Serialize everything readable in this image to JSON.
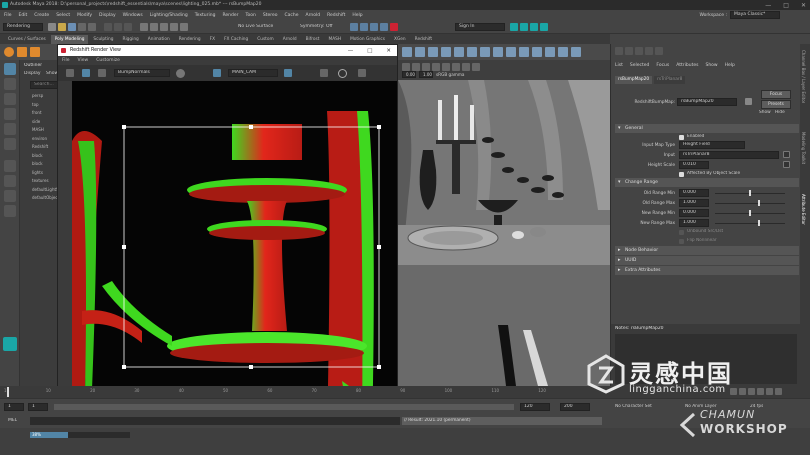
{
  "titlebar": {
    "text": "Autodesk Maya 2018: D:\\personal_projects\\redshift_essentials\\maya\\scenes\\lighting_025.mb* --- rsBumpMap20",
    "controls": [
      "—",
      "□",
      "✕"
    ]
  },
  "menubar": {
    "items": [
      "File",
      "Edit",
      "Create",
      "Select",
      "Modify",
      "Display",
      "Windows",
      "Lighting/Shading",
      "Texturing",
      "Render",
      "Toon",
      "Stereo",
      "Cache",
      "Arnold",
      "Redshift",
      "Help"
    ],
    "workspace_label": "Workspace :",
    "workspace_value": "Maya Classic*"
  },
  "statusline": {
    "mode": "Rendering",
    "live_surface": "No Live Surface",
    "symmetry": "Symmetry: Off",
    "sign_in": "Sign In"
  },
  "shelf": {
    "tabs": [
      "Curves / Surfaces",
      "Poly Modeling",
      "Sculpting",
      "Rigging",
      "Animation",
      "Rendering",
      "FX",
      "FX Caching",
      "Custom",
      "Arnold",
      "Bifrost",
      "MASH",
      "Motion Graphics",
      "XGen",
      "Redshift"
    ],
    "active_tab": "Poly Modeling"
  },
  "outliner": {
    "title": "Outliner",
    "menu": [
      "Display",
      "Show"
    ],
    "search": "Search...",
    "items": [
      "persp",
      "top",
      "front",
      "side",
      "MASH",
      "environ",
      "Redshift",
      "block",
      "block",
      "lights",
      "textures",
      "defaultLightSet",
      "defaultObjectSet"
    ]
  },
  "render_view": {
    "title": "Redshift Render View",
    "menu": [
      "File",
      "View",
      "Customize"
    ],
    "aov_value": "BumpNormals",
    "camera_value": "MAIN_CAM",
    "controls": [
      "—",
      "□",
      "✕"
    ]
  },
  "viewport": {
    "exposure": "0.00",
    "gamma": "1.00",
    "colorspace": "sRGB gamma"
  },
  "attribute_editor": {
    "menu": [
      "List",
      "Selected",
      "Focus",
      "Attributes",
      "Show",
      "Help"
    ],
    "tabs": [
      "rsBumpMap20",
      "rsTriPlanar8"
    ],
    "node_label": "RedshiftBumpMap:",
    "node_value": "rsBumpMap20",
    "focus_btn": "Focus",
    "presets_btn": "Presets",
    "show_btn": "Show",
    "hide_btn": "Hide",
    "general": {
      "title": "General",
      "enabled": "Enabled",
      "input_map_type_label": "Input Map Type",
      "input_map_type_value": "Height Field",
      "input_label": "Input",
      "input_value": "rsTriPlanar8",
      "height_scale_label": "Height Scale",
      "height_scale_value": "0.010",
      "affected_by_scale": "Affected By Object Scale"
    },
    "change_range": {
      "title": "Change Range",
      "rows": [
        {
          "label": "Old Range Min",
          "value": "0.000",
          "fill": 0.5
        },
        {
          "label": "Old Range Max",
          "value": "1.000",
          "fill": 0.63
        },
        {
          "label": "New Range Min",
          "value": "0.000",
          "fill": 0.5
        },
        {
          "label": "New Range Max",
          "value": "1.000",
          "fill": 0.63
        }
      ],
      "unbound_src": "Unbound Src/Dst",
      "flip": "Flip Nonlinear"
    },
    "collapsed": [
      "Node Behavior",
      "UUID",
      "Extra Attributes"
    ],
    "notes_label": "Notes: rsBumpMap20",
    "select_btn": "Select",
    "load_btn": "Load Attributes",
    "copy_btn": "Copy Tab"
  },
  "side_tabs": [
    "Channel Box / Layer Editor",
    "Modeling Toolkit",
    "Attribute Editor"
  ],
  "time": {
    "ticks": [
      "1",
      "10",
      "20",
      "30",
      "40",
      "50",
      "60",
      "70",
      "80",
      "90",
      "100",
      "110",
      "120"
    ],
    "start": "1",
    "start2": "1",
    "end_inner": "120",
    "end_outer": "200",
    "char_set": "No Character Set",
    "anim_layer": "No Anim Layer",
    "fps": "24 fps"
  },
  "cmdline": {
    "lang": "MEL",
    "progress_label": "38%",
    "progress": 0.38,
    "result": "// Result: 2021.10 (permanent)"
  },
  "watermark": {
    "cn_text": "灵感中国",
    "url": "lingganchina.com",
    "brand1": "CHAMUN",
    "brand2": "WORKSHOP"
  },
  "colors": {
    "accent": "#5285a6",
    "render_red": "#e2261b",
    "render_green": "#3fd81f",
    "maya_teal": "#1aa6a6"
  }
}
